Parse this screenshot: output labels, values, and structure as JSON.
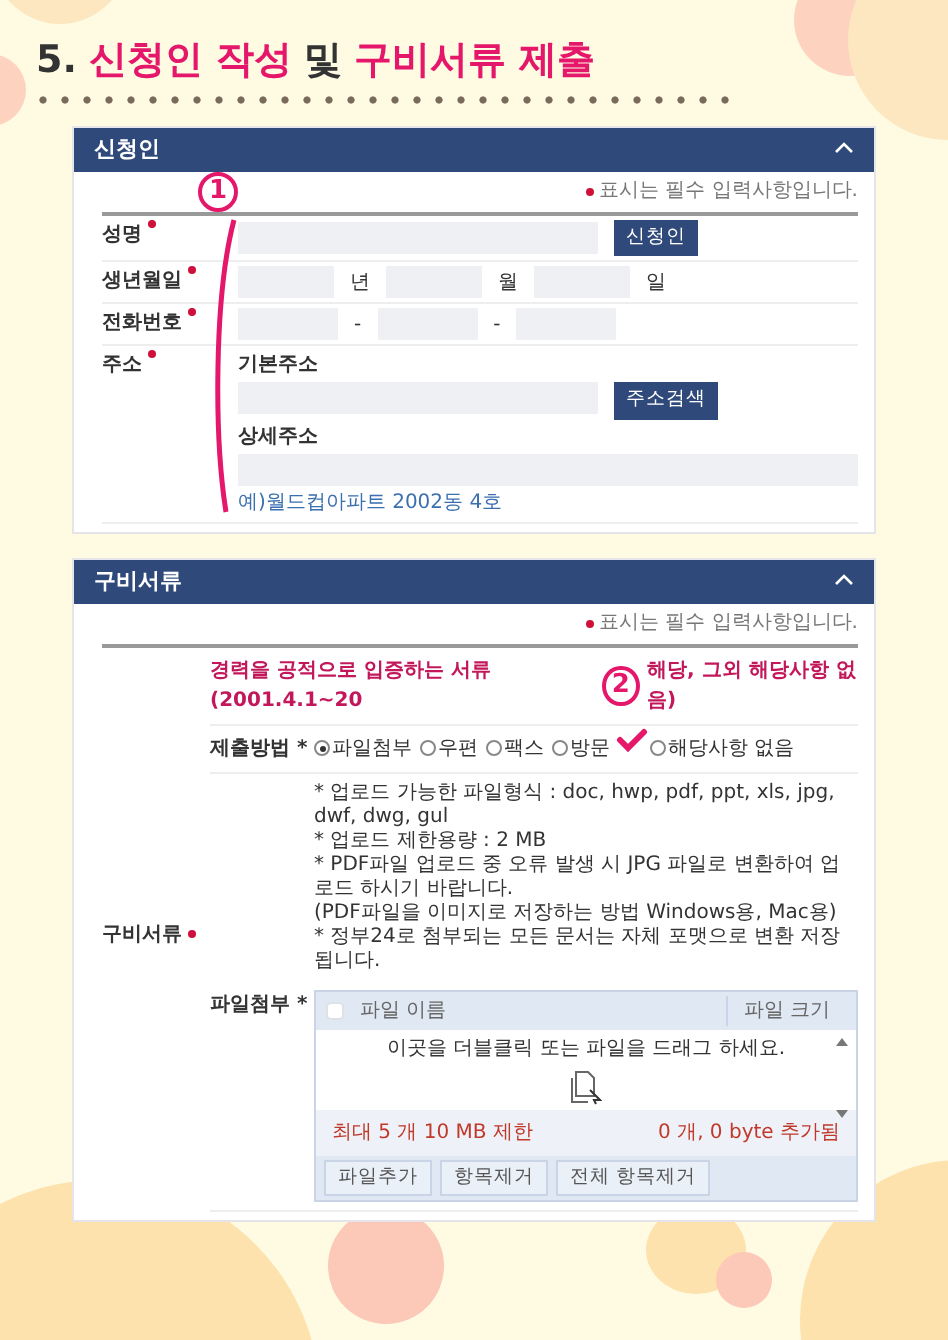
{
  "title": {
    "parts": [
      {
        "text": "5.",
        "highlight": false
      },
      {
        "text": "신청인 작성",
        "highlight": true
      },
      {
        "text": "및",
        "highlight": false
      },
      {
        "text": "구비서류 제출",
        "highlight": true
      }
    ]
  },
  "applicant": {
    "title": "신청인",
    "expanded": true,
    "required_note": "표시는 필수 입력사항입니다.",
    "annotation": "1",
    "fields": [
      {
        "kind": "name",
        "label": "성명",
        "required": true,
        "button": "신청인"
      },
      {
        "kind": "date",
        "label": "생년월일",
        "required": true,
        "units": [
          "년",
          "월",
          "일"
        ]
      },
      {
        "kind": "phone",
        "label": "전화번호",
        "required": true,
        "separators": [
          "-",
          "-"
        ]
      },
      {
        "kind": "address",
        "label": "주소",
        "required": true,
        "basic_label": "기본주소",
        "button": "주소검색",
        "detail_label": "상세주소",
        "hint": "예)월드컵아파트 2002동 4호"
      }
    ]
  },
  "documents": {
    "title": "구비서류",
    "expanded": true,
    "required_note": "표시는 필수 입력사항입니다.",
    "label": "구비서류",
    "required": true,
    "doc_title": "경력을 공적으로 입증하는 서류(2001.4.1~20",
    "annotation": "2",
    "doc_title_end": "해당, 그외 해당사항 없음)",
    "method": {
      "label": "제출방법 *",
      "options": [
        {
          "label": "파일첨부",
          "selected": true
        },
        {
          "label": "우편",
          "selected": false
        },
        {
          "label": "팩스",
          "selected": false
        },
        {
          "label": "방문",
          "selected": false
        },
        {
          "label": "해당사항 없음",
          "selected": false
        }
      ]
    },
    "notes": [
      "* 업로드 가능한 파일형식 : doc, hwp, pdf, ppt, xls, jpg, dwf, dwg, gul",
      "* 업로드 제한용량 : 2 MB",
      "* PDF파일 업로드 중 오류 발생 시 JPG 파일로 변환하여 업로드 하시기 바랍니다.",
      "(PDF파일을 이미지로 저장하는 방법 Windows용, Mac용)",
      "* 정부24로 첨부되는 모든 문서는 자체 포맷으로 변환 저장됩니다."
    ],
    "attach": {
      "label": "파일첨부 *",
      "checked": false,
      "columns": [
        "파일 이름",
        "파일 크기"
      ],
      "drop_hint": "이곳을 더블클릭 또는 파일을 드래그 하세요.",
      "limit": "최대 5 개 10 MB 제한",
      "status": "0 개, 0 byte 추가됨",
      "buttons": [
        "파일추가",
        "항목제거",
        "전체 항목제거"
      ]
    }
  }
}
